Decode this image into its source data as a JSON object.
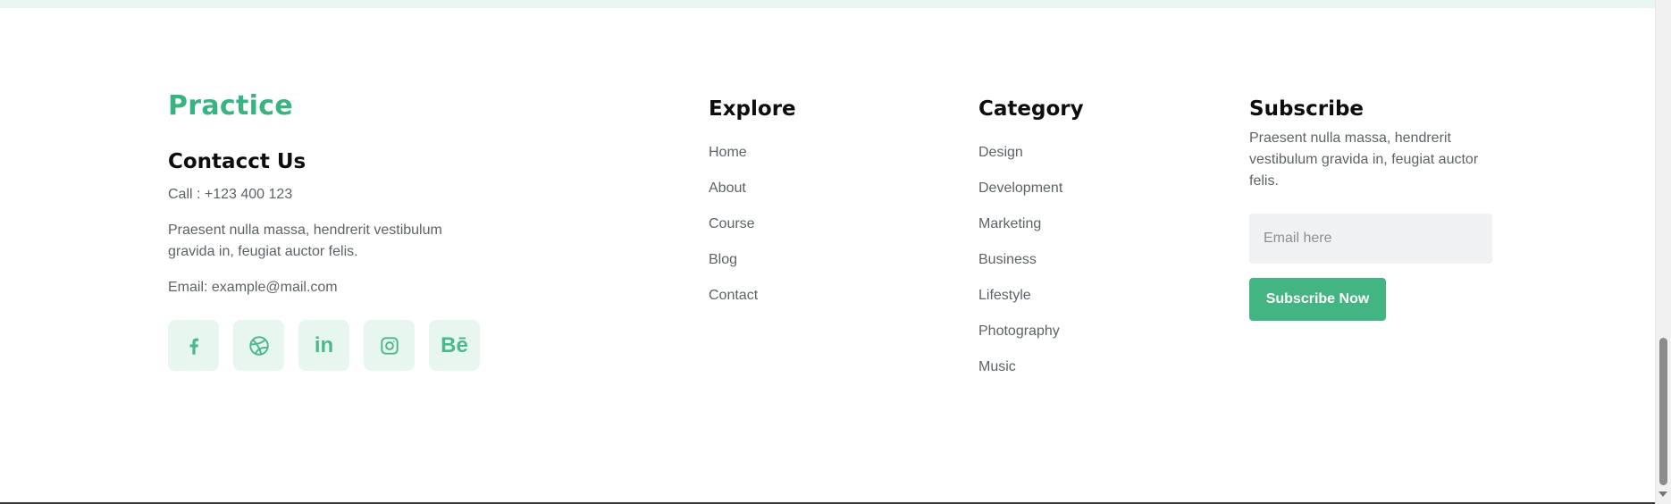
{
  "brand": {
    "logo": "Practice"
  },
  "contact": {
    "title": "Contacct Us",
    "call": "Call : +123 400 123",
    "description": "Praesent nulla massa, hendrerit vestibulum gravida in, feugiat auctor felis.",
    "email": "Email: example@mail.com"
  },
  "socials": [
    {
      "icon": "facebook-icon"
    },
    {
      "icon": "dribbble-icon"
    },
    {
      "icon": "linkedin-icon"
    },
    {
      "icon": "instagram-icon"
    },
    {
      "icon": "behance-icon"
    }
  ],
  "social_text": {
    "linkedin": "in",
    "behance": "Bē"
  },
  "explore": {
    "title": "Explore",
    "links": [
      "Home",
      "About",
      "Course",
      "Blog",
      "Contact"
    ]
  },
  "category": {
    "title": "Category",
    "links": [
      "Design",
      "Development",
      "Marketing",
      "Business",
      "Lifestyle",
      "Photography",
      "Music"
    ]
  },
  "subscribe": {
    "title": "Subscribe",
    "description": "Praesent nulla massa, hendrerit vestibulum gravida in, feugiat auctor felis.",
    "email_placeholder": "Email here",
    "button_label": "Subscribe Now"
  },
  "colors": {
    "accent": "#43b582",
    "social_bg": "#e8f6f0",
    "top_strip": "#e9f7f2",
    "input_bg": "#f0f1f2"
  }
}
